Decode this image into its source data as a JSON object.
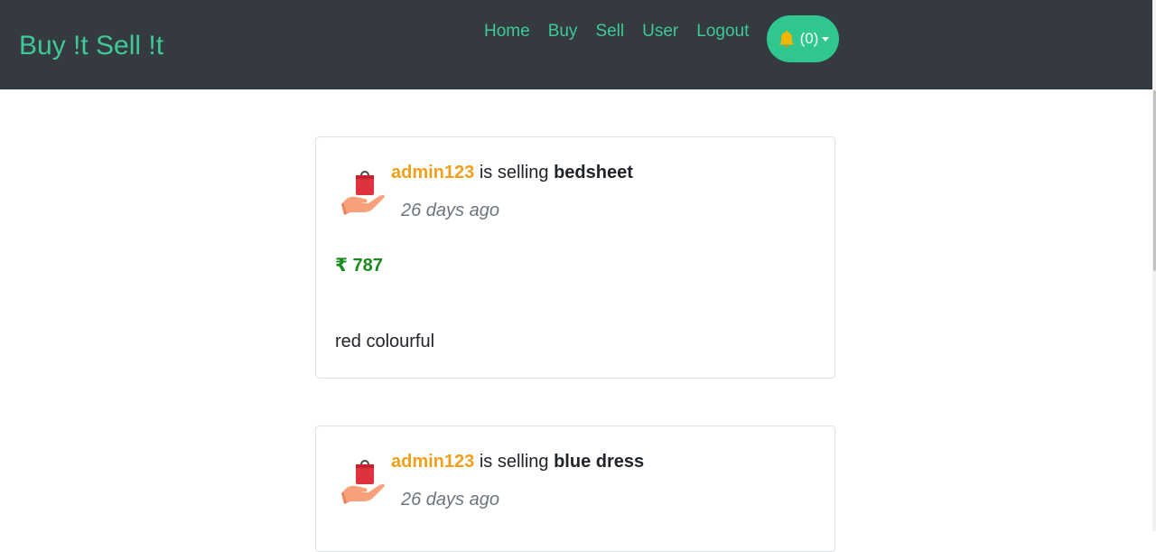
{
  "navbar": {
    "brand": "Buy !t Sell !t",
    "links": [
      {
        "label": "Home"
      },
      {
        "label": "Buy"
      },
      {
        "label": "Sell"
      },
      {
        "label": "User"
      },
      {
        "label": "Logout"
      }
    ],
    "notifications": {
      "count_label": "(0)",
      "icon": "bell-icon"
    }
  },
  "colors": {
    "navbar_bg": "#343a40",
    "accent": "#3ec996",
    "notif_bg": "#2fc78f",
    "seller": "#f0a01a",
    "price": "#198a1c",
    "muted": "#6c757d"
  },
  "listings": [
    {
      "seller": "admin123",
      "verb": " is selling ",
      "product": "bedsheet",
      "time": "26 days ago",
      "price": "₹ 787",
      "description": "red colourful",
      "icon": "shopping-bag-in-hand-icon"
    },
    {
      "seller": "admin123",
      "verb": " is selling ",
      "product": "blue dress",
      "time": "26 days ago",
      "icon": "shopping-bag-in-hand-icon"
    }
  ]
}
